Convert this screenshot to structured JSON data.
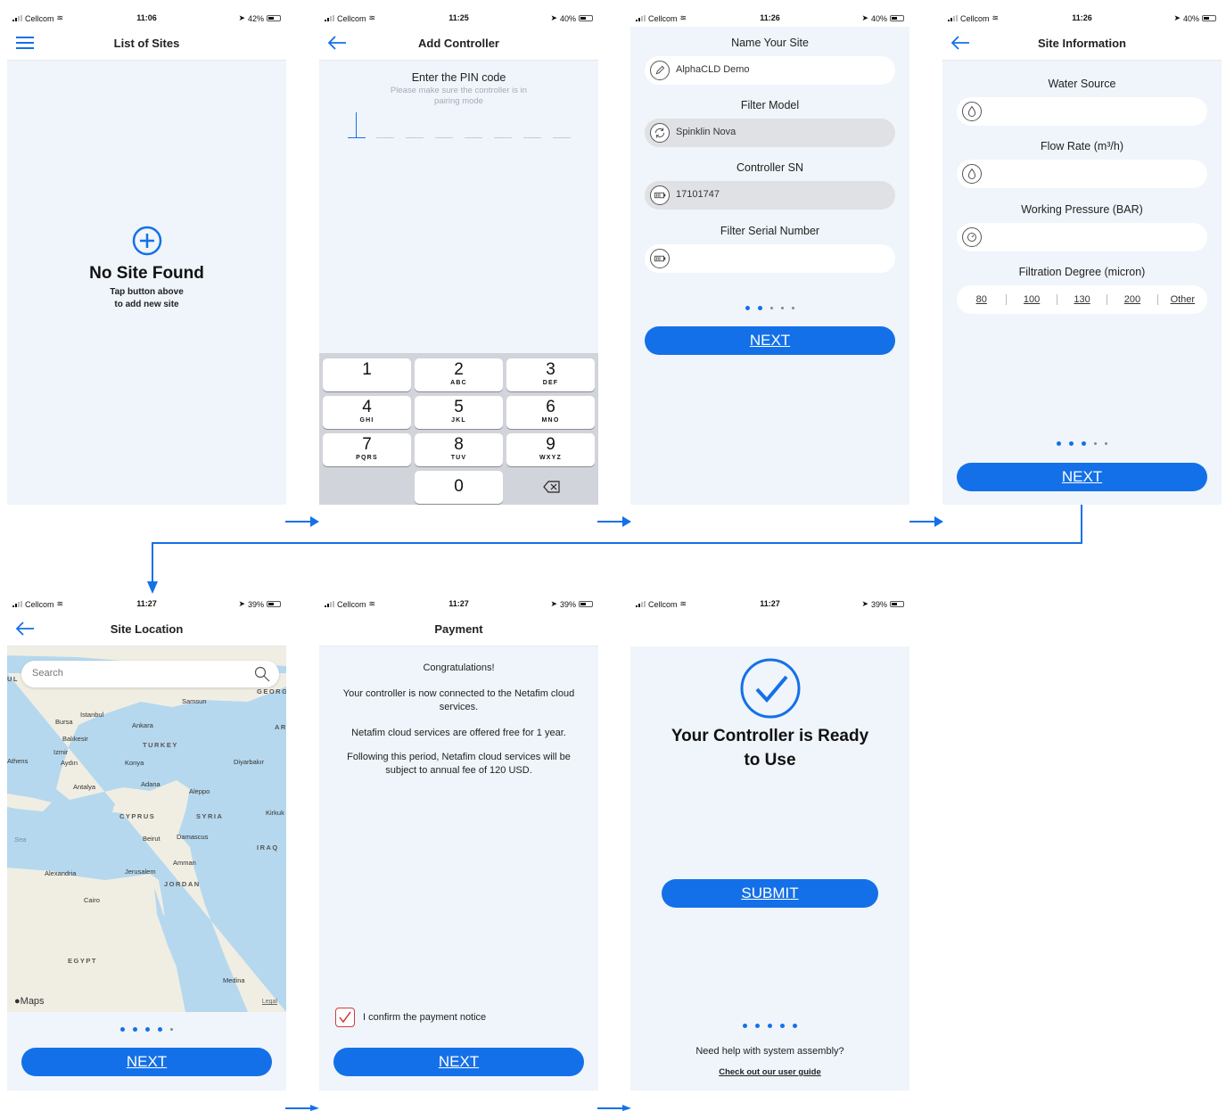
{
  "status": {
    "carrier": "Cellcom",
    "s1": {
      "time": "11:06",
      "battery": "42%"
    },
    "s2": {
      "time": "11:25",
      "battery": "40%"
    },
    "s3": {
      "time": "11:26",
      "battery": "40%"
    },
    "s4": {
      "time": "11:26",
      "battery": "40%"
    },
    "s5": {
      "time": "11:27",
      "battery": "39%"
    },
    "s6": {
      "time": "11:27",
      "battery": "39%"
    },
    "s7": {
      "time": "11:27",
      "battery": "39%"
    }
  },
  "list_sites": {
    "title": "List of Sites",
    "empty_title": "No Site Found",
    "empty_line1": "Tap button above",
    "empty_line2": "to add new site"
  },
  "add_controller": {
    "title": "Add Controller",
    "pin_title": "Enter the PIN code",
    "pin_hint_1": "Please make sure the controller is in",
    "pin_hint_2": "pairing mode",
    "keys": [
      {
        "digit": "1",
        "letters": ""
      },
      {
        "digit": "2",
        "letters": "ABC"
      },
      {
        "digit": "3",
        "letters": "DEF"
      },
      {
        "digit": "4",
        "letters": "GHI"
      },
      {
        "digit": "5",
        "letters": "JKL"
      },
      {
        "digit": "6",
        "letters": "MNO"
      },
      {
        "digit": "7",
        "letters": "PQRS"
      },
      {
        "digit": "8",
        "letters": "TUV"
      },
      {
        "digit": "9",
        "letters": "WXYZ"
      },
      {
        "digit": "0",
        "letters": ""
      }
    ]
  },
  "name_site": {
    "site_label": "Name Your Site",
    "site_value": "AlphaCLD Demo",
    "filter_label": "Filter Model",
    "filter_value": "Spinklin  Nova",
    "sn_label": "Controller SN",
    "sn_value": "17101747",
    "serial_label": "Filter Serial Number",
    "serial_value": "",
    "next": "NEXT"
  },
  "site_info": {
    "title": "Site Information",
    "water_label": "Water Source",
    "flow_label": "Flow Rate (m³/h)",
    "pressure_label": "Working Pressure (BAR)",
    "degree_label": "Filtration Degree (micron)",
    "degrees": [
      "80",
      "100",
      "130",
      "200",
      "Other"
    ],
    "next": "NEXT"
  },
  "site_location": {
    "title": "Site Location",
    "search_placeholder": "Search",
    "maps_brand": "Maps",
    "legal": "Legal",
    "next": "NEXT",
    "places": [
      "UL",
      "GEORGI",
      "Samsun",
      "Istanbul",
      "Bursa",
      "Ankara",
      "AR",
      "Balıkesir",
      "TURKEY",
      "Izmir",
      "Athens",
      "Aydın",
      "Konya",
      "Diyarbakır",
      "Antalya",
      "Adana",
      "Aleppo",
      "CYPRUS",
      "SYRIA",
      "Kirkuk",
      "Sea",
      "Beirut",
      "Damascus",
      "IRAQ",
      "Alexandria",
      "Jerusalem",
      "Amman",
      "JORDAN",
      "Cairo",
      "EGYPT",
      "Medina"
    ]
  },
  "payment": {
    "title": "Payment",
    "congrats": "Congratulations!",
    "p1": "Your controller is now connected to the Netafim cloud services.",
    "p2": "Netafim cloud services are offered free for 1 year.",
    "p3": "Following this period, Netafim cloud services will be subject to annual fee of 120 USD.",
    "confirm": "I confirm the payment notice",
    "next": "NEXT"
  },
  "ready": {
    "title_1": "Your Controller is Ready",
    "title_2": "to Use",
    "submit": "SUBMIT",
    "help": "Need help with system assembly?",
    "guide": "Check out our user guide"
  },
  "colors": {
    "accent": "#1470e8",
    "background": "#eff5fb",
    "confirm": "#d33a3a"
  }
}
